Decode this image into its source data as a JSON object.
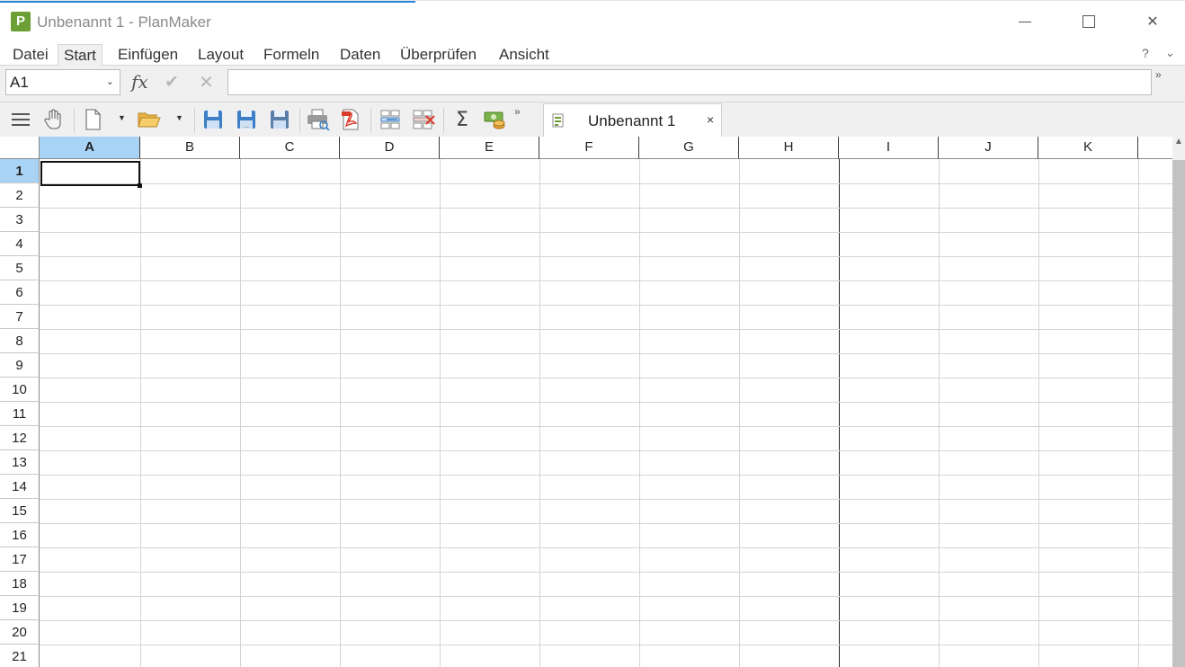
{
  "window": {
    "logo_letter": "P",
    "title": "Unbenannt 1 - PlanMaker",
    "minimize": "",
    "maximize": "",
    "close": "✕"
  },
  "menu": {
    "items": [
      "Datei",
      "Start",
      "Einfügen",
      "Layout",
      "Formeln",
      "Daten",
      "Überprüfen",
      "Ansicht"
    ],
    "active": "Start",
    "help": "?",
    "collapse": "⌄"
  },
  "formula_bar": {
    "cell_reference": "A1",
    "fx_label": "fx",
    "confirm": "✔",
    "cancel": "✕",
    "value": "",
    "expand": "»"
  },
  "toolbar": {
    "more": "»",
    "icons": [
      "menu-icon",
      "hand-icon",
      "new-document-icon",
      "open-folder-icon",
      "save-icon",
      "save-as-icon",
      "save-all-icon",
      "print-preview-icon",
      "export-pdf-icon",
      "insert-cells-icon",
      "delete-cells-icon",
      "sum-icon",
      "currency-icon"
    ]
  },
  "document_tab": {
    "label": "Unbenannt 1",
    "close": "×"
  },
  "sheet": {
    "columns": [
      "A",
      "B",
      "C",
      "D",
      "E",
      "F",
      "G",
      "H",
      "I",
      "J",
      "K"
    ],
    "rows": [
      "1",
      "2",
      "3",
      "4",
      "5",
      "6",
      "7",
      "8",
      "9",
      "10",
      "11",
      "12",
      "13",
      "14",
      "15",
      "16",
      "17",
      "18",
      "19",
      "20",
      "21"
    ],
    "selected_column": "A",
    "selected_row": "1",
    "page_break_after_column": "H"
  },
  "colors": {
    "accent": "#2b88d8",
    "logo": "#6ca037",
    "header_selected": "#a9d3f5",
    "save_blue": "#3d7fc6",
    "pdf_red": "#d93b2b"
  }
}
